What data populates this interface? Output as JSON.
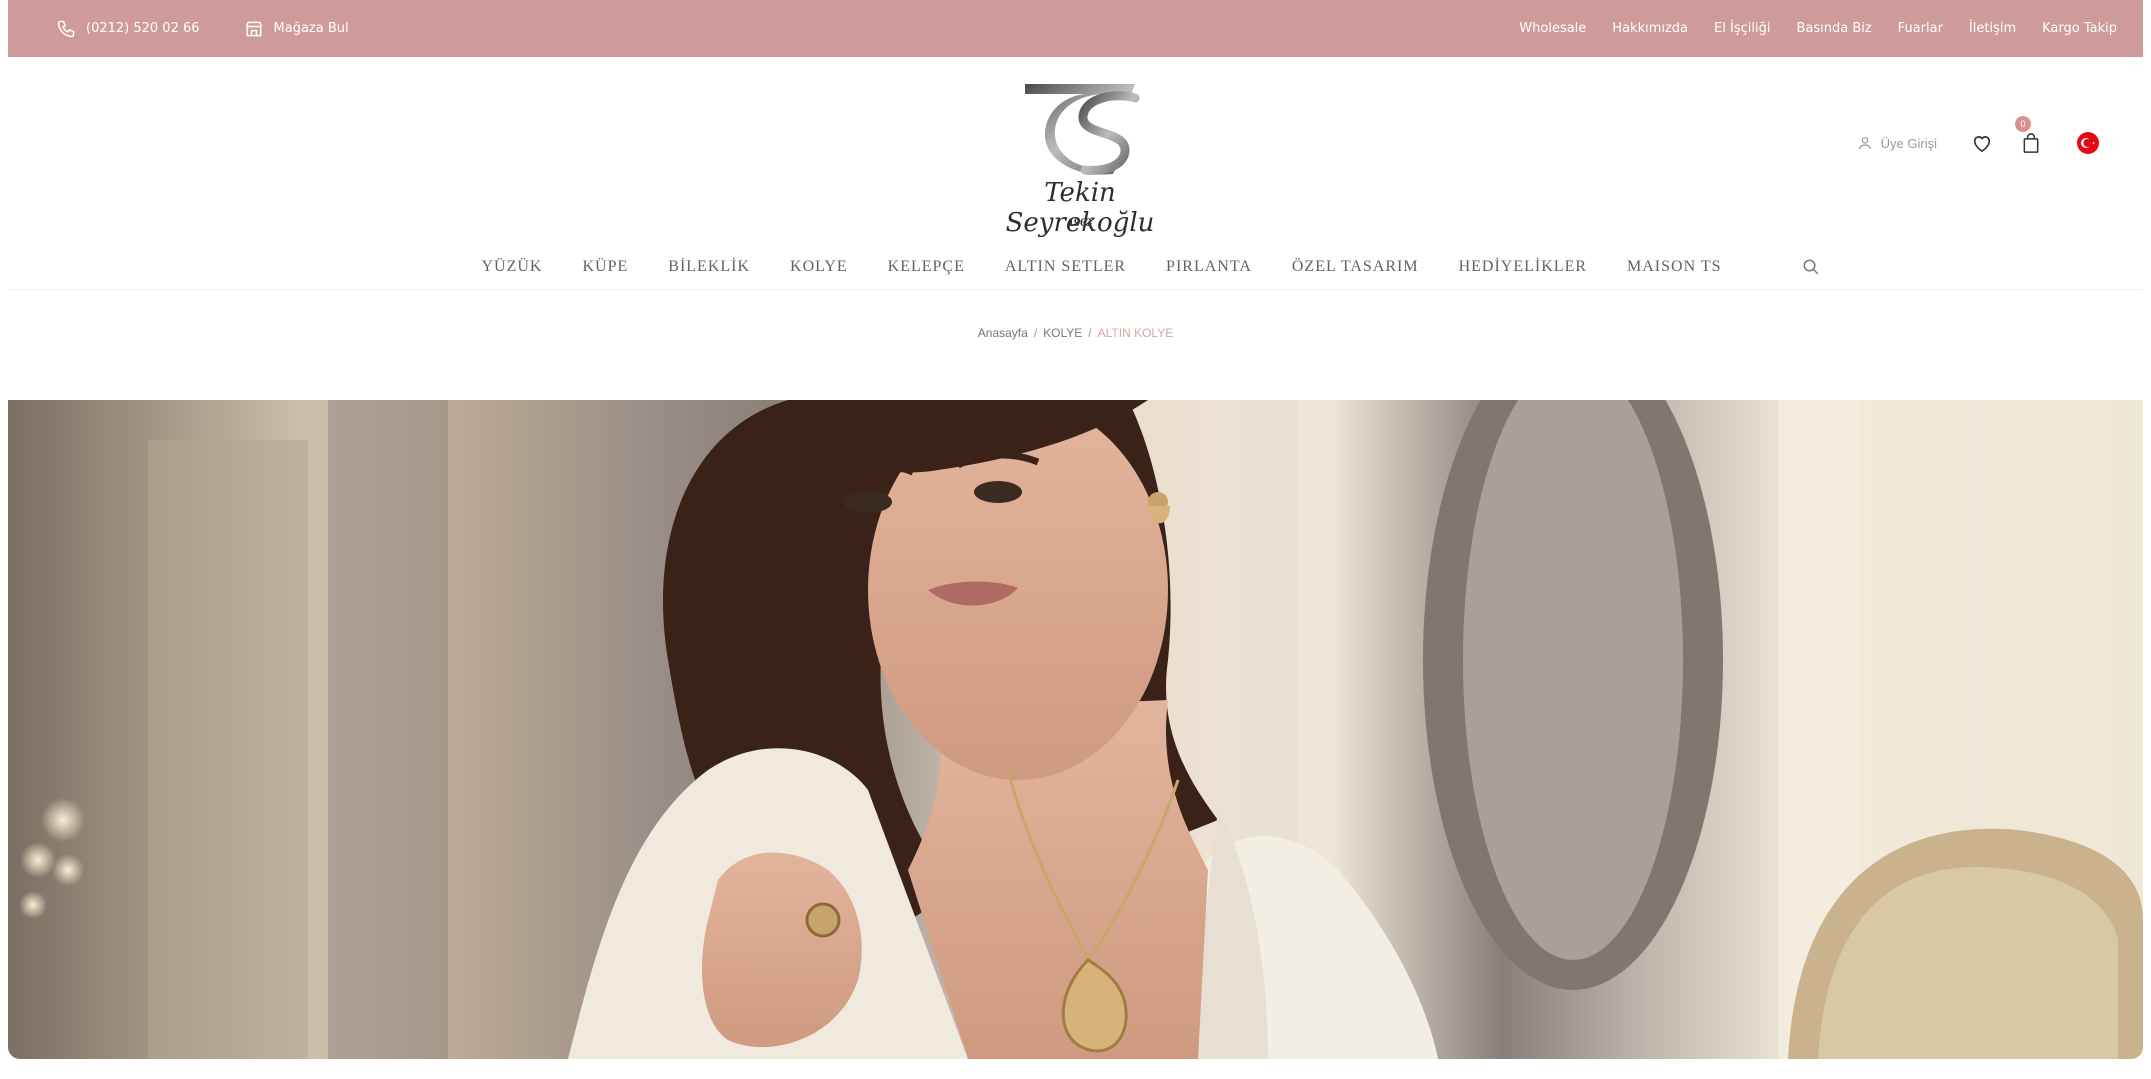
{
  "topbar": {
    "phone": "(0212) 520 02 66",
    "store_finder": "Mağaza Bul",
    "links": [
      "Wholesale",
      "Hakkımızda",
      "El İşçiliği",
      "Basında Biz",
      "Fuarlar",
      "İletişim",
      "Kargo Takip"
    ]
  },
  "brand": {
    "script_name": "Tekin Seyrekoğlu",
    "year": "1963",
    "monogram": "TS"
  },
  "header": {
    "login_label": "Üye Girişi",
    "cart_count": "0",
    "language": "TR"
  },
  "nav": {
    "items": [
      "YÜZÜK",
      "KÜPE",
      "BİLEKLİK",
      "KOLYE",
      "KELEPÇE",
      "ALTIN SETLER",
      "PIRLANTA",
      "ÖZEL TASARIM",
      "HEDİYELİKLER",
      "MAISON TS"
    ]
  },
  "breadcrumb": {
    "home": "Anasayfa",
    "category": "KOLYE",
    "current": "ALTIN KOLYE"
  },
  "colors": {
    "topbar": "#cf9a9a",
    "accent": "#d79191",
    "nav_text": "#6a5f5f"
  },
  "icons": {
    "phone": "phone-icon",
    "store": "store-icon",
    "user": "user-icon",
    "heart": "heart-icon",
    "bag": "shopping-bag-icon",
    "search": "search-icon",
    "flag": "turkey-flag-icon"
  }
}
